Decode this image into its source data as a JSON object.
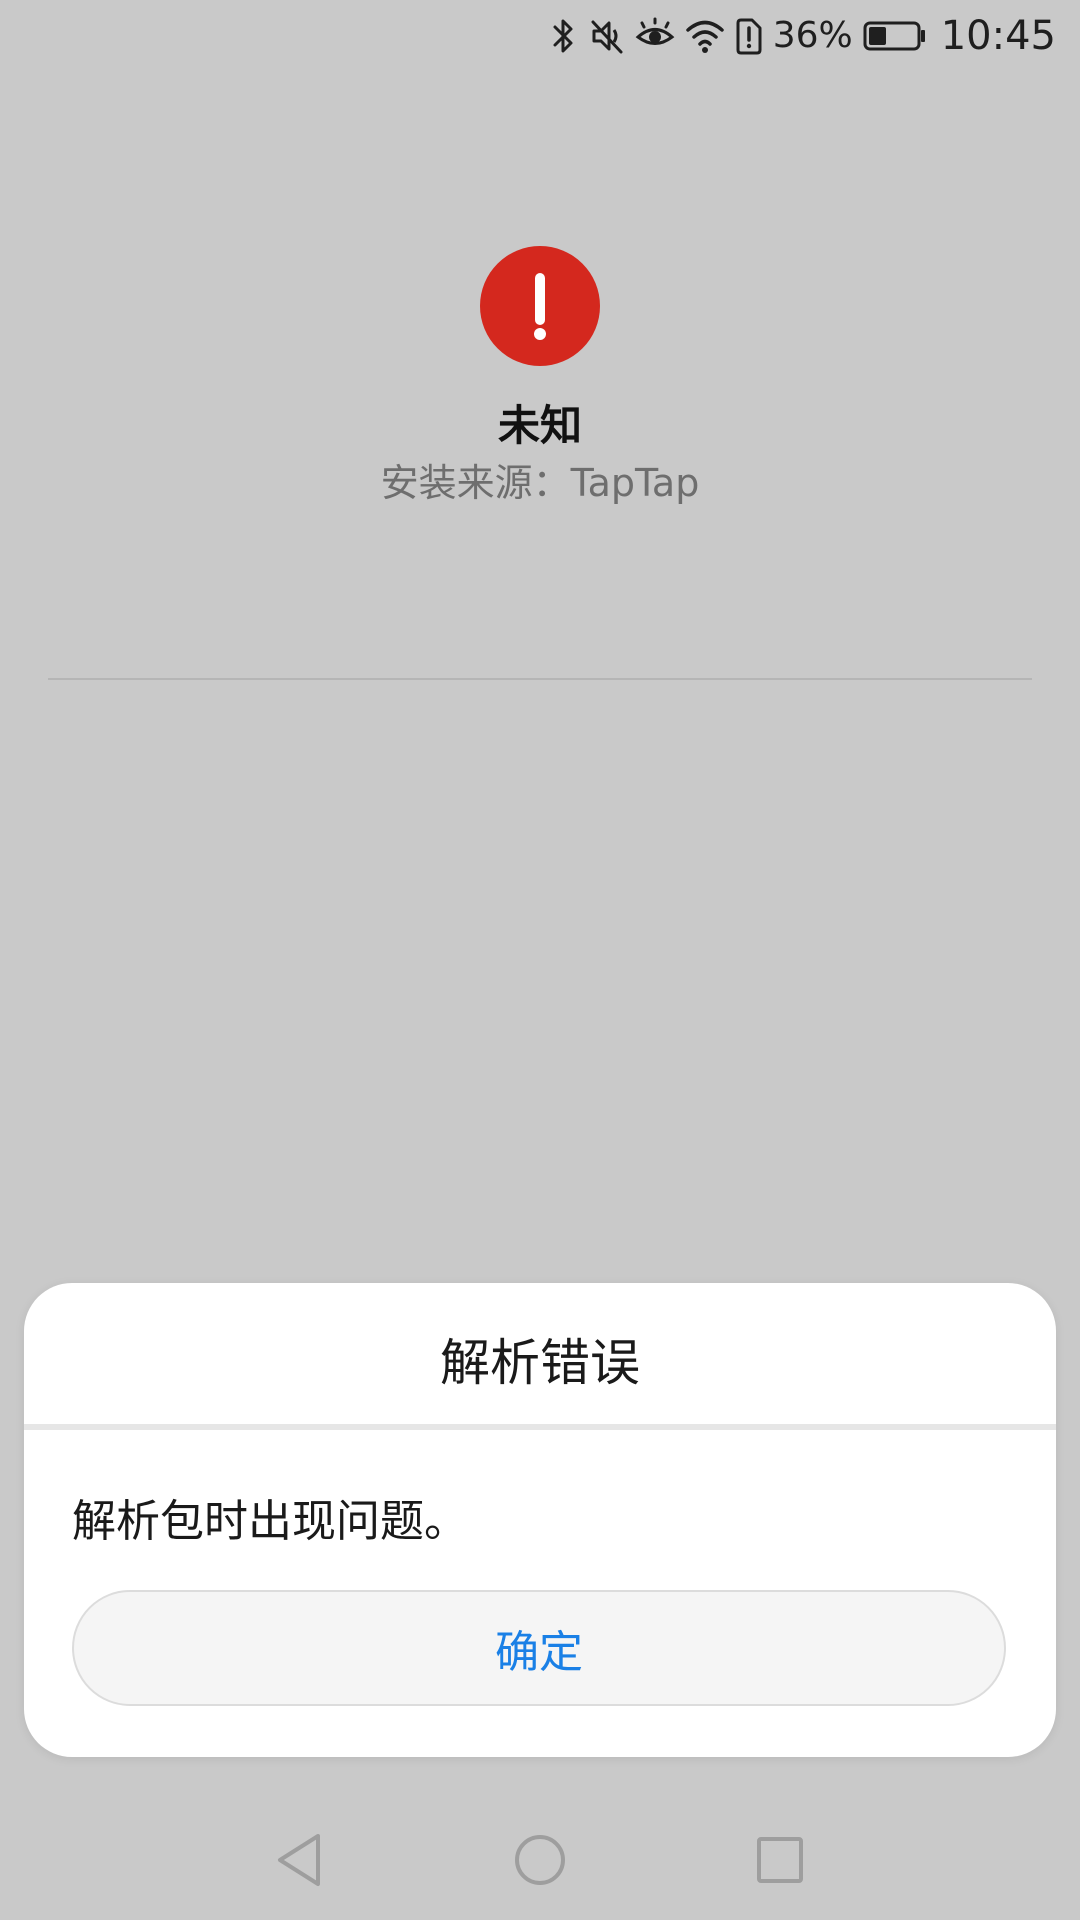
{
  "status_bar": {
    "battery_percent": "36%",
    "battery_level": 0.36,
    "time": "10:45",
    "icons": [
      "bluetooth-icon",
      "mute-icon",
      "eye-comfort-icon",
      "wifi-icon",
      "sim-alert-icon",
      "battery-icon"
    ]
  },
  "app": {
    "icon": "alert-icon",
    "icon_color": "#d4281e",
    "name": "未知",
    "source": "安装来源：TapTap"
  },
  "dialog": {
    "title": "解析错误",
    "message": "解析包时出现问题。",
    "ok_label": "确定",
    "accent_color": "#1a80e6"
  },
  "nav_bar": {
    "icons": [
      "back-icon",
      "home-icon",
      "recents-icon"
    ]
  }
}
